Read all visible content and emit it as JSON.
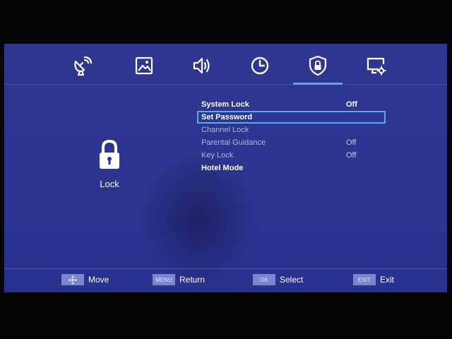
{
  "tabs": [
    {
      "name": "channel",
      "icon": "satellite-dish-icon"
    },
    {
      "name": "picture",
      "icon": "image-icon"
    },
    {
      "name": "sound",
      "icon": "speaker-icon"
    },
    {
      "name": "time",
      "icon": "clock-icon"
    },
    {
      "name": "lock",
      "icon": "shield-lock-icon",
      "active": true
    },
    {
      "name": "setup",
      "icon": "monitor-settings-icon"
    }
  ],
  "side_panel": {
    "icon": "padlock-icon",
    "label": "Lock"
  },
  "menu": [
    {
      "label": "System Lock",
      "value": "Off"
    },
    {
      "label": "Set Password",
      "value": ""
    },
    {
      "label": "Channel Lock",
      "value": ""
    },
    {
      "label": "Parental Guidance",
      "value": "Off"
    },
    {
      "label": "Key Lock",
      "value": "Off"
    },
    {
      "label": "Hotel Mode",
      "value": ""
    }
  ],
  "footer": {
    "move": {
      "key_icon": "directional-pad-icon",
      "label": "Move"
    },
    "return": {
      "key": "MENU",
      "label": "Return"
    },
    "select": {
      "key": "OK",
      "label": "Select"
    },
    "exit": {
      "key": "EXIT",
      "label": "Exit"
    }
  },
  "colors": {
    "background": "#2f3791",
    "highlight": "#5fa8e8",
    "key_bg": "#7c85cf"
  }
}
